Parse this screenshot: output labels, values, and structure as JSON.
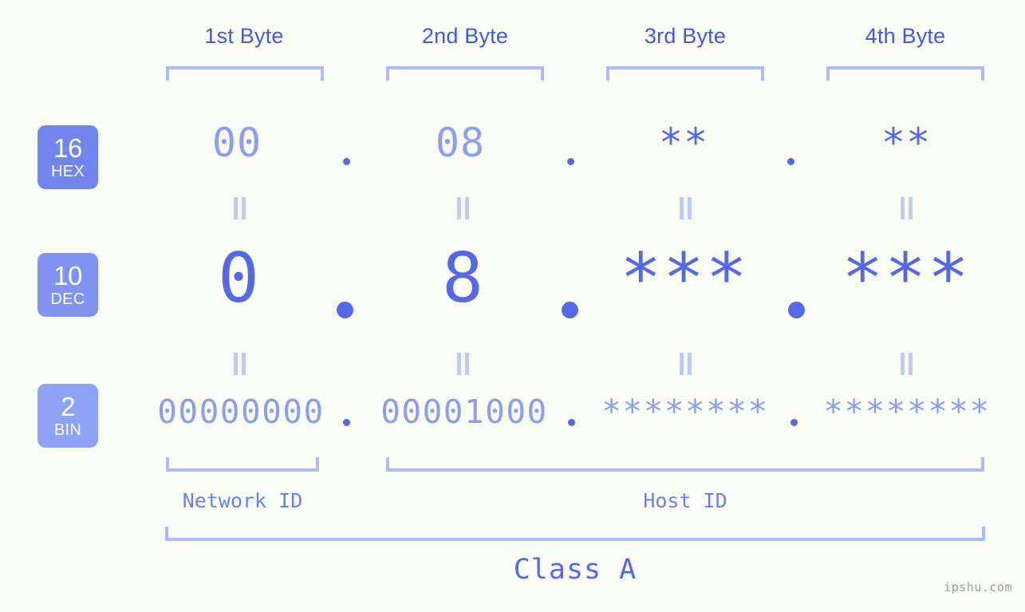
{
  "background_color": "#fbfdf7",
  "colors": {
    "strong_blue": "#5468e8",
    "label_blue": "#4458e4",
    "mid_periwinkle": "#8e9df0",
    "bracket": "#aeb9f9",
    "equals": "#bfcaf8",
    "badge_hex": "#7285ee",
    "badge_dec": "#8093f3",
    "badge_bin": "#8ea3f8",
    "watermark": "#9b9b9b"
  },
  "byte_headers": [
    {
      "label": "1st Byte"
    },
    {
      "label": "2nd Byte"
    },
    {
      "label": "3rd Byte"
    },
    {
      "label": "4th Byte"
    }
  ],
  "bases": [
    {
      "number": "16",
      "name": "HEX"
    },
    {
      "number": "10",
      "name": "DEC"
    },
    {
      "number": "2",
      "name": "BIN"
    }
  ],
  "rows": {
    "hex": {
      "base_number": "16",
      "base_name": "HEX",
      "values": [
        "00",
        "08",
        "**",
        "**"
      ],
      "separator": "."
    },
    "dec": {
      "base_number": "10",
      "base_name": "DEC",
      "values": [
        "0",
        "8",
        "***",
        "***"
      ],
      "separator": "."
    },
    "bin": {
      "base_number": "2",
      "base_name": "BIN",
      "values": [
        "00000000",
        "00001000",
        "********",
        "********"
      ],
      "separator": "."
    }
  },
  "equals_marks": [
    "=",
    "=",
    "=",
    "=",
    "=",
    "=",
    "=",
    "="
  ],
  "sections": [
    {
      "id": "network-id",
      "label": "Network ID"
    },
    {
      "id": "host-id",
      "label": "Host ID"
    }
  ],
  "class_label": "Class A",
  "watermark": "ipshu.com",
  "chart_data": {
    "type": "table",
    "title": "Class A IP address byte breakdown",
    "categories": [
      "1st Byte",
      "2nd Byte",
      "3rd Byte",
      "4th Byte"
    ],
    "series": [
      {
        "name": "HEX",
        "values": [
          "00",
          "08",
          "**",
          "**"
        ]
      },
      {
        "name": "DEC",
        "values": [
          "0",
          "8",
          "***",
          "***"
        ]
      },
      {
        "name": "BIN",
        "values": [
          "00000000",
          "00001000",
          "********",
          "********"
        ]
      }
    ],
    "annotations": [
      "Network ID covers 1st Byte",
      "Host ID covers 2nd-4th Bytes",
      "Class A"
    ]
  }
}
